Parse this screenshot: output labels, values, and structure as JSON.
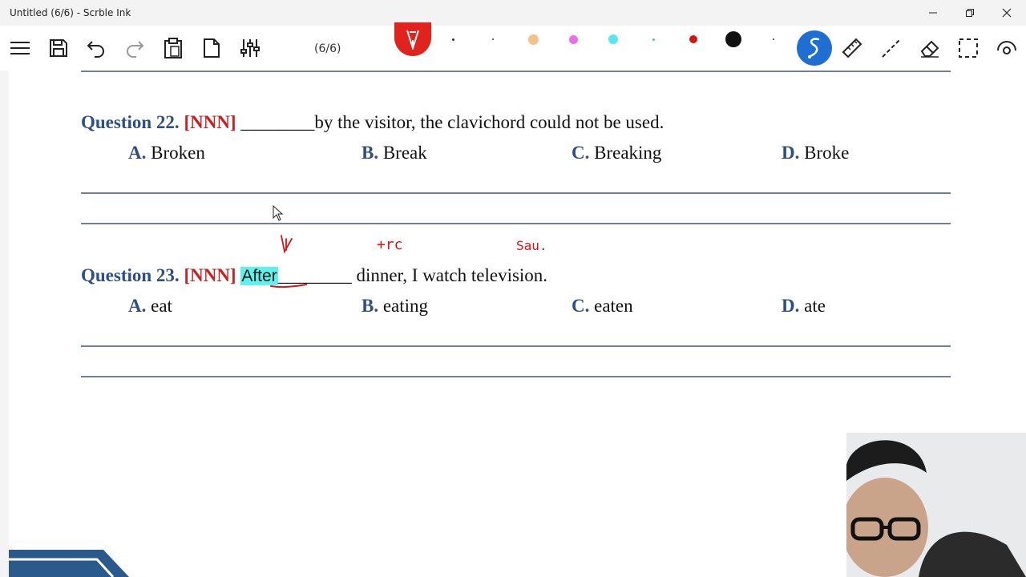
{
  "window": {
    "title": "Untitled (6/6) - Scrble Ink"
  },
  "toolbar": {
    "page_indicator": "(6/6)"
  },
  "colors": {
    "pen_red": "#e0231c",
    "tool_blue": "#1e6fd1",
    "swatch_orange": "#f5c089",
    "swatch_pink": "#ee6be9",
    "swatch_cyan": "#59e6f0",
    "swatch_green": "#43d67a",
    "swatch_red": "#d41414",
    "swatch_black": "#111111"
  },
  "questions": [
    {
      "number": "Question 22.",
      "tag": "[NNN]",
      "blank": "________",
      "text": "by the visitor, the clavichord could not be used.",
      "options": [
        {
          "letter": "A.",
          "text": "Broken"
        },
        {
          "letter": "B.",
          "text": "Break"
        },
        {
          "letter": "C.",
          "text": "Breaking"
        },
        {
          "letter": "D.",
          "text": "Broke"
        }
      ]
    },
    {
      "number": "Question 23.",
      "tag": "[NNN]",
      "highlighted_word": "After",
      "blank": "________",
      "text": "dinner, I watch television.",
      "options": [
        {
          "letter": "A.",
          "text": "eat"
        },
        {
          "letter": "B.",
          "text": "eating"
        },
        {
          "letter": "C.",
          "text": "eaten"
        },
        {
          "letter": "D.",
          "text": "ate"
        }
      ]
    }
  ],
  "annotations": {
    "ink_1": "+rc",
    "ink_2": "Sau."
  },
  "icons": [
    "menu-icon",
    "save-icon",
    "undo-icon",
    "redo-icon",
    "clipboard-icon",
    "page-icon",
    "sliders-icon",
    "pen-icon",
    "lasso-icon",
    "ruler-icon",
    "line-icon",
    "eraser-icon",
    "select-icon",
    "view-icon",
    "minimize-icon",
    "maximize-icon",
    "close-icon",
    "cursor-icon"
  ]
}
